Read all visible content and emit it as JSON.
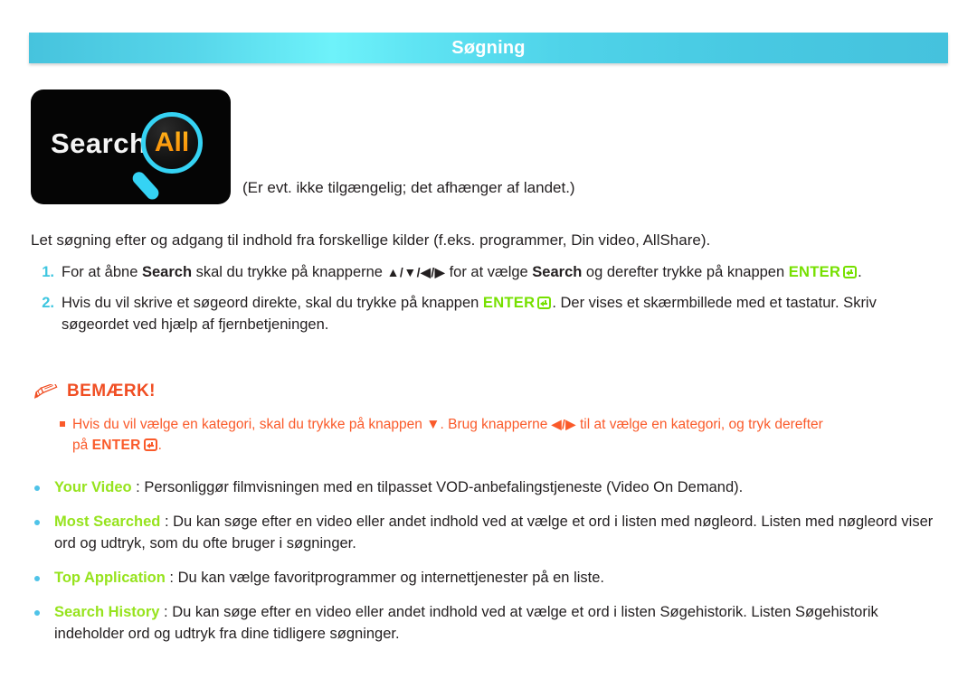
{
  "header": {
    "title": "Søgning",
    "gradient_from": "#46c3dd",
    "gradient_mid": "#6ef2fa",
    "gradient_to": "#45c2dd"
  },
  "logo": {
    "word": "Search",
    "magnifier_text": "All",
    "bg_color": "#050505",
    "word_color": "#f4f4f4",
    "accent_color": "#35d3f4",
    "all_color": "#f98a06",
    "icon": "magnifier-icon"
  },
  "caption": "(Er evt. ikke tilgængelig; det afhænger af landet.)",
  "intro": "Let søgning efter og adgang til indhold fra forskellige kilder (f.eks. programmer, Din video, AllShare).",
  "steps": [
    {
      "number": "1.",
      "part1": "For at åbne ",
      "bold1": "Search",
      "part2": " skal du trykke på knapperne ",
      "arrows": "▲/▼/◀/▶",
      "part3": " for at vælge ",
      "bold2": "Search",
      "part4": " og derefter trykke på knappen ",
      "enter": "ENTER",
      "part5": "."
    },
    {
      "number": "2.",
      "part1": "Hvis du vil skrive et søgeord direkte, skal du trykke på knappen ",
      "enter": "ENTER",
      "part2": ". Der vises et skærmbillede med et tastatur. Skriv søgeordet ved hjælp af fjernbetjeningen."
    }
  ],
  "note": {
    "icon": "pencil-icon",
    "title": "BEMÆRK!",
    "color": "#fa5a2a",
    "bullet_part1": "Hvis du vil vælge en kategori, skal du trykke på knappen ",
    "bullet_arrow_down": "▼",
    "bullet_part2": ". Brug knapperne ",
    "bullet_arrows_lr": "◀/▶",
    "bullet_part3": " til at vælge en kategori, og tryk derefter",
    "bullet_line2_prefix": "på ",
    "bullet_line2_enter": "ENTER",
    "bullet_line2_suffix": "."
  },
  "features": [
    {
      "name": "Your Video",
      "separator": " : ",
      "description": "Personliggør filmvisningen med en tilpasset VOD-anbefalingstjeneste (Video On Demand)."
    },
    {
      "name": "Most Searched",
      "separator": " : ",
      "description": "Du kan søge efter en video eller andet indhold ved at vælge et ord i listen med nøgleord. Listen med nøgleord viser ord og udtryk, som du ofte bruger i søgninger."
    },
    {
      "name": "Top Application",
      "separator": " : ",
      "description": "Du kan vælge favoritprogrammer og internettjenester på en liste."
    },
    {
      "name": "Search History",
      "separator": " : ",
      "description": "Du kan søge efter en video eller andet indhold ved at vælge et ord i listen Søgehistorik. Listen Søgehistorik indeholder ord og udtryk fra dine tidligere søgninger."
    }
  ],
  "colors": {
    "cyan": "#4fc3e8",
    "green": "#96e31d",
    "orange_red": "#fa5a2a",
    "text": "#231f20"
  }
}
